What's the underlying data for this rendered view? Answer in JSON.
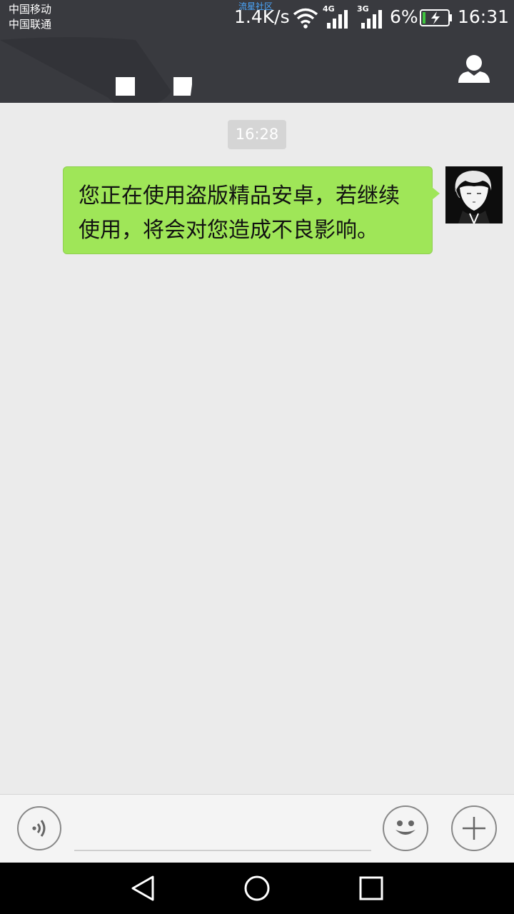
{
  "status_bar": {
    "carrier_1": "中国移动",
    "carrier_2": "中国联通",
    "net_brand": "流星社区",
    "net_speed": "1.4K/s",
    "sig1_label": "4G",
    "sig2_label": "3G",
    "battery_pct": "6%",
    "time": "16:31"
  },
  "header": {
    "profile_icon": "person-icon"
  },
  "chat": {
    "timestamp": "16:28",
    "message_line_1": "您正在使用盗版精品安卓，若继续",
    "message_line_2": "使用，将会对您造成不良影响。"
  },
  "input_bar": {
    "voice_icon": "voice-icon",
    "emoji_icon": "emoji-icon",
    "plus_icon": "plus-icon",
    "text_value": ""
  },
  "nav_bar": {
    "back_icon": "back-triangle-icon",
    "home_icon": "home-circle-icon",
    "recents_icon": "recents-square-icon"
  },
  "colors": {
    "bar_dark": "#393a3f",
    "bubble_green": "#9fe658",
    "chat_bg": "#ebebeb",
    "net_brand_blue": "#4aa8ff"
  }
}
